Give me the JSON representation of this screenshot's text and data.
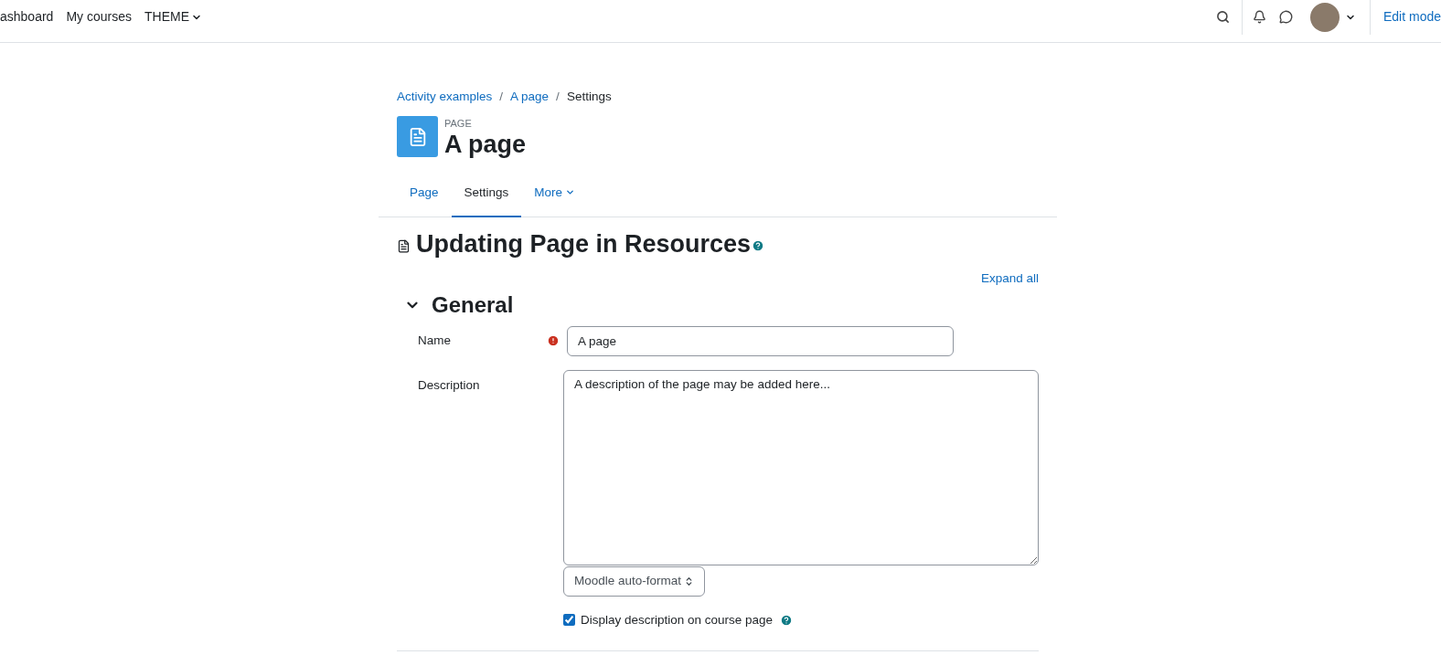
{
  "navbar": {
    "items": [
      {
        "label": "ashboard",
        "has_menu": false
      },
      {
        "label": "My courses",
        "has_menu": false
      },
      {
        "label": "THEME",
        "has_menu": true
      }
    ],
    "edit_mode": "Edit mode"
  },
  "breadcrumb": [
    {
      "label": "Activity examples",
      "kind": "link"
    },
    {
      "label": "A page",
      "kind": "link",
      "separator_before": "/"
    },
    {
      "label": "Settings",
      "kind": "current",
      "separator_before": "/"
    }
  ],
  "header": {
    "type_label": "PAGE",
    "title": "A page"
  },
  "tabs": [
    {
      "label": "Page",
      "selected": false,
      "has_menu": false
    },
    {
      "label": "Settings",
      "selected": true,
      "has_menu": false
    },
    {
      "label": "More",
      "selected": false,
      "has_menu": true
    }
  ],
  "heading": "Updating Page in Resources",
  "expand_all": "Expand all",
  "section": {
    "title": "General",
    "expanded": true
  },
  "name_field": {
    "label": "Name",
    "required": true,
    "value": "A page"
  },
  "description_field": {
    "label": "Description",
    "value": "A description of the page may be added here..."
  },
  "format_select": {
    "value": "Moodle auto-format"
  },
  "display_checkbox": {
    "label": "Display description on course page",
    "checked": true
  }
}
